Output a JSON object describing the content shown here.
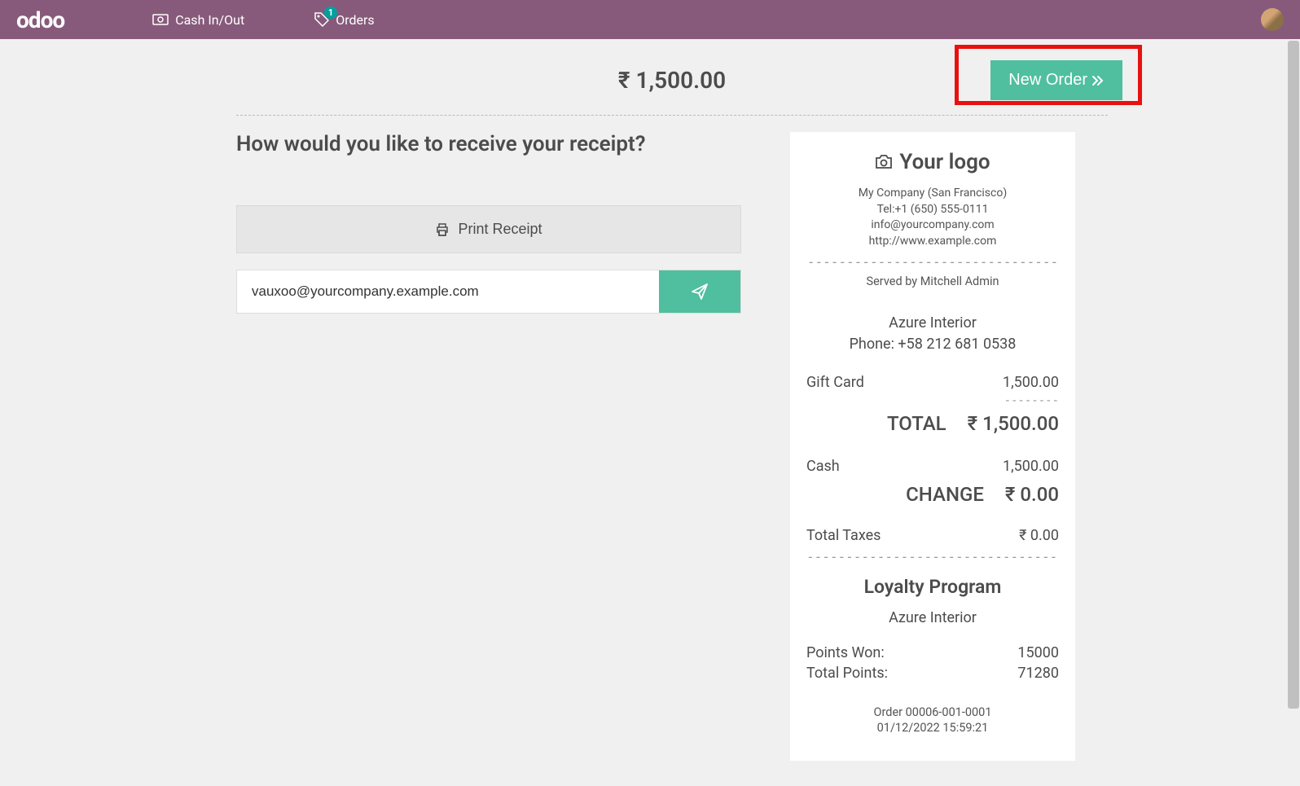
{
  "navbar": {
    "logo": "odoo",
    "cash_label": "Cash In/Out",
    "orders_label": "Orders",
    "orders_badge": "1"
  },
  "summary": {
    "total_display": "₹ 1,500.00",
    "new_order_label": "New Order"
  },
  "receipt_prompt": {
    "heading": "How would you like to receive your receipt?",
    "print_label": "Print Receipt",
    "email_value": "vauxoo@yourcompany.example.com"
  },
  "receipt": {
    "logo_text": "Your logo",
    "company": "My Company (San Francisco)",
    "tel": "Tel:+1 (650) 555-0111",
    "email": "info@yourcompany.com",
    "web": "http://www.example.com",
    "served_by": "Served by Mitchell Admin",
    "customer_name": "Azure Interior",
    "customer_phone": "Phone: +58 212 681 0538",
    "items": [
      {
        "label": "Gift Card",
        "value": "1,500.00"
      }
    ],
    "total_label": "TOTAL",
    "total_value": "₹ 1,500.00",
    "tender_label": "Cash",
    "tender_value": "1,500.00",
    "change_label": "CHANGE",
    "change_value": "₹ 0.00",
    "taxes_label": "Total Taxes",
    "taxes_value": "₹ 0.00",
    "loyalty_title": "Loyalty Program",
    "loyalty_customer": "Azure Interior",
    "points_won_label": "Points Won:",
    "points_won_value": "15000",
    "total_points_label": "Total Points:",
    "total_points_value": "71280",
    "order_ref": "Order 00006-001-0001",
    "order_datetime": "01/12/2022 15:59:21"
  }
}
